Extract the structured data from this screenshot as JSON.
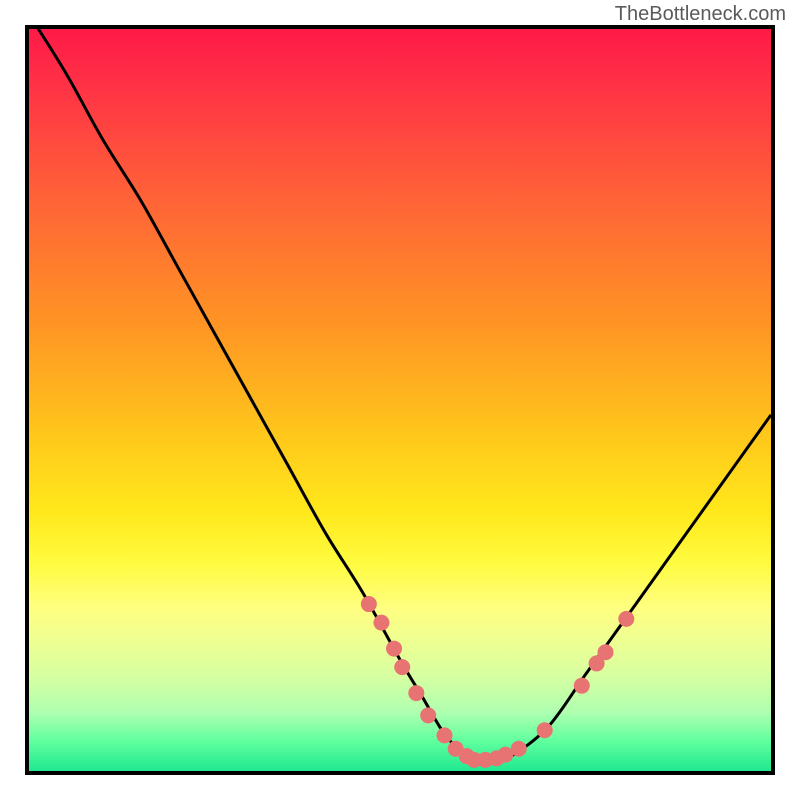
{
  "watermark": "TheBottleneck.com",
  "chart_data": {
    "type": "line",
    "title": "",
    "xlabel": "",
    "ylabel": "",
    "xlim": [
      0,
      100
    ],
    "ylim": [
      0,
      100
    ],
    "curve": {
      "x": [
        0,
        5,
        10,
        15,
        20,
        25,
        30,
        35,
        40,
        45,
        50,
        53,
        56,
        59,
        62,
        65,
        70,
        75,
        80,
        85,
        90,
        95,
        100
      ],
      "y": [
        102,
        94,
        85,
        77,
        68,
        59,
        50,
        41,
        32,
        24,
        15,
        10,
        5,
        2,
        1,
        2,
        6,
        13,
        20,
        27,
        34,
        41,
        48
      ]
    },
    "points": [
      {
        "x": 45.8,
        "y": 22.5
      },
      {
        "x": 47.5,
        "y": 20.0
      },
      {
        "x": 49.2,
        "y": 16.5
      },
      {
        "x": 50.3,
        "y": 14.0
      },
      {
        "x": 52.2,
        "y": 10.5
      },
      {
        "x": 53.8,
        "y": 7.5
      },
      {
        "x": 56.0,
        "y": 4.8
      },
      {
        "x": 57.5,
        "y": 3.0
      },
      {
        "x": 59.0,
        "y": 2.0
      },
      {
        "x": 60.0,
        "y": 1.5
      },
      {
        "x": 61.5,
        "y": 1.5
      },
      {
        "x": 63.0,
        "y": 1.7
      },
      {
        "x": 64.2,
        "y": 2.2
      },
      {
        "x": 66.0,
        "y": 3.0
      },
      {
        "x": 69.5,
        "y": 5.5
      },
      {
        "x": 74.5,
        "y": 11.5
      },
      {
        "x": 76.5,
        "y": 14.5
      },
      {
        "x": 77.7,
        "y": 16.0
      },
      {
        "x": 80.5,
        "y": 20.5
      }
    ],
    "point_color": "#e77373",
    "curve_color": "#000000"
  }
}
